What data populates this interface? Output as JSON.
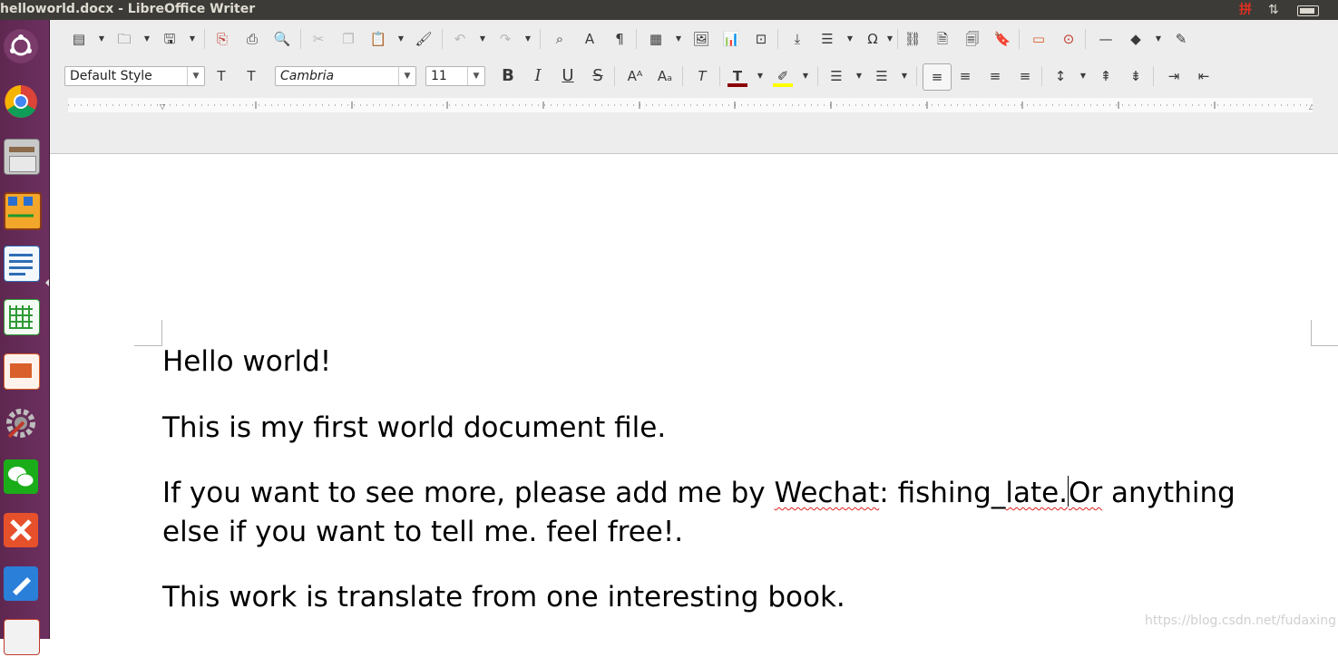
{
  "window": {
    "title": "helloworld.docx - LibreOffice Writer",
    "tray_ime": "拼"
  },
  "launcher": [
    {
      "name": "ubuntu-dash-icon",
      "color": "#d9542b"
    },
    {
      "name": "chrome-icon",
      "color": "#3b7dd8"
    },
    {
      "name": "files-icon",
      "color": "#8a8a8a"
    },
    {
      "name": "kolourpaint-icon",
      "color": "#e08a1e"
    },
    {
      "name": "writer-icon",
      "color": "#2e6db4"
    },
    {
      "name": "calc-icon",
      "color": "#2f9a37"
    },
    {
      "name": "impress-icon",
      "color": "#d9602a"
    },
    {
      "name": "system-settings-icon",
      "color": "#7a7a7a"
    },
    {
      "name": "wechat-icon",
      "color": "#1aad19"
    },
    {
      "name": "xmind-icon",
      "color": "#e6512b"
    },
    {
      "name": "notes-icon",
      "color": "#2a7fd8"
    },
    {
      "name": "app-icon",
      "color": "#d8d8d8"
    }
  ],
  "format": {
    "paragraph_style": "Default Style",
    "font_name": "Cambria",
    "font_size": "11"
  },
  "colors": {
    "font_color": "#8b0000",
    "highlight_color": "#ffff00"
  },
  "document": {
    "paragraphs": [
      "Hello world!",
      "This is my first world document file."
    ],
    "p3_before": "If you want to see more, please add me by ",
    "p3_wechat": "Wechat",
    "p3_mid": ": fishing_",
    "p3_late": "late.",
    "p3_or": "Or",
    "p3_after": " anything",
    "p3_line2": "else if you want to tell me. feel free!.",
    "p4": "This work is translate from one interesting book."
  },
  "watermark": "https://blog.csdn.net/fudaxing"
}
